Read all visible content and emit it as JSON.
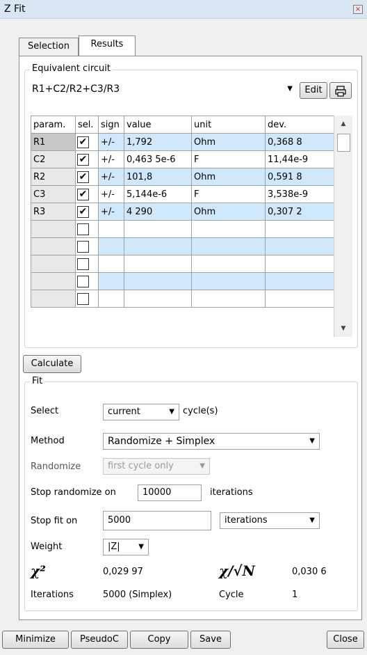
{
  "window": {
    "title": "Z Fit",
    "close_glyph": "×"
  },
  "tabs": [
    {
      "label": "Selection"
    },
    {
      "label": "Results"
    }
  ],
  "equivalent_circuit": {
    "legend": "Equivalent circuit",
    "circuit": "R1+C2/R2+C3/R3",
    "edit_label": "Edit",
    "print_icon": "printer-icon"
  },
  "table": {
    "headers": [
      "param.",
      "sel.",
      "sign",
      "value",
      "unit",
      "dev."
    ],
    "rows": [
      {
        "param": "R1",
        "sel": "✔",
        "sign": "+/-",
        "value": "1,792",
        "unit": "Ohm",
        "dev": "0,368 8"
      },
      {
        "param": "C2",
        "sel": "✔",
        "sign": "+/-",
        "value": "0,463 5e-6",
        "unit": "F",
        "dev": "11,44e-9"
      },
      {
        "param": "R2",
        "sel": "✔",
        "sign": "+/-",
        "value": "101,8",
        "unit": "Ohm",
        "dev": "0,591 8"
      },
      {
        "param": "C3",
        "sel": "✔",
        "sign": "+/-",
        "value": "5,144e-6",
        "unit": "F",
        "dev": "3,538e-9"
      },
      {
        "param": "R3",
        "sel": "✔",
        "sign": "+/-",
        "value": "4 290",
        "unit": "Ohm",
        "dev": "0,307 2"
      },
      {
        "param": "",
        "sel": "",
        "sign": "",
        "value": "",
        "unit": "",
        "dev": ""
      },
      {
        "param": "",
        "sel": "",
        "sign": "",
        "value": "",
        "unit": "",
        "dev": ""
      },
      {
        "param": "",
        "sel": "",
        "sign": "",
        "value": "",
        "unit": "",
        "dev": ""
      },
      {
        "param": "",
        "sel": "",
        "sign": "",
        "value": "",
        "unit": "",
        "dev": ""
      },
      {
        "param": "",
        "sel": "",
        "sign": "",
        "value": "",
        "unit": "",
        "dev": ""
      }
    ],
    "scroll_up": "▲",
    "scroll_down": "▼"
  },
  "calculate_label": "Calculate",
  "fit": {
    "legend": "Fit",
    "select_label": "Select",
    "select_value": "current",
    "select_suffix": "cycle(s)",
    "method_label": "Method",
    "method_value": "Randomize + Simplex",
    "randomize_label": "Randomize",
    "randomize_value": "first cycle only",
    "stop_randomize_label": "Stop randomize on",
    "stop_randomize_value": "10000",
    "stop_randomize_suffix": "iterations",
    "stop_fit_label": "Stop fit on",
    "stop_fit_value": "5000",
    "stop_fit_unit": "iterations",
    "weight_label": "Weight",
    "weight_value": "|Z|",
    "chi2_label": "χ²",
    "chi2_value": "0,029 97",
    "chi_sqrtn_label": "χ/√N",
    "chi_sqrtn_value": "0,030 6",
    "iterations_label": "Iterations",
    "iterations_value": "5000 (Simplex)",
    "cycle_label": "Cycle",
    "cycle_value": "1"
  },
  "footer": {
    "minimize": "Minimize",
    "pseudoc": "PseudoC",
    "copy": "Copy",
    "save": "Save",
    "close": "Close"
  }
}
